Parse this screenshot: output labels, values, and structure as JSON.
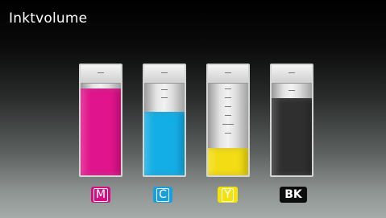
{
  "header": {
    "title": "Inktvolume"
  },
  "inks": [
    {
      "id": "m",
      "label": "M",
      "level_percent": 79,
      "fill_color": "#e0148c",
      "badge_color": "#d40f86",
      "label_color": "#ffffff"
    },
    {
      "id": "c",
      "label": "C",
      "level_percent": 58,
      "fill_color": "#14aee6",
      "badge_color": "#1a9fdd",
      "label_color": "#ffffff"
    },
    {
      "id": "y",
      "label": "Y",
      "level_percent": 25,
      "fill_color": "#f3dc14",
      "badge_color": "#f2e30f",
      "label_color": "#ffffff"
    },
    {
      "id": "bk",
      "label": "BK",
      "level_percent": 70,
      "fill_color": "#2f2f2f",
      "badge_color": "#0d0d0d",
      "label_color": "#ffffff"
    }
  ]
}
